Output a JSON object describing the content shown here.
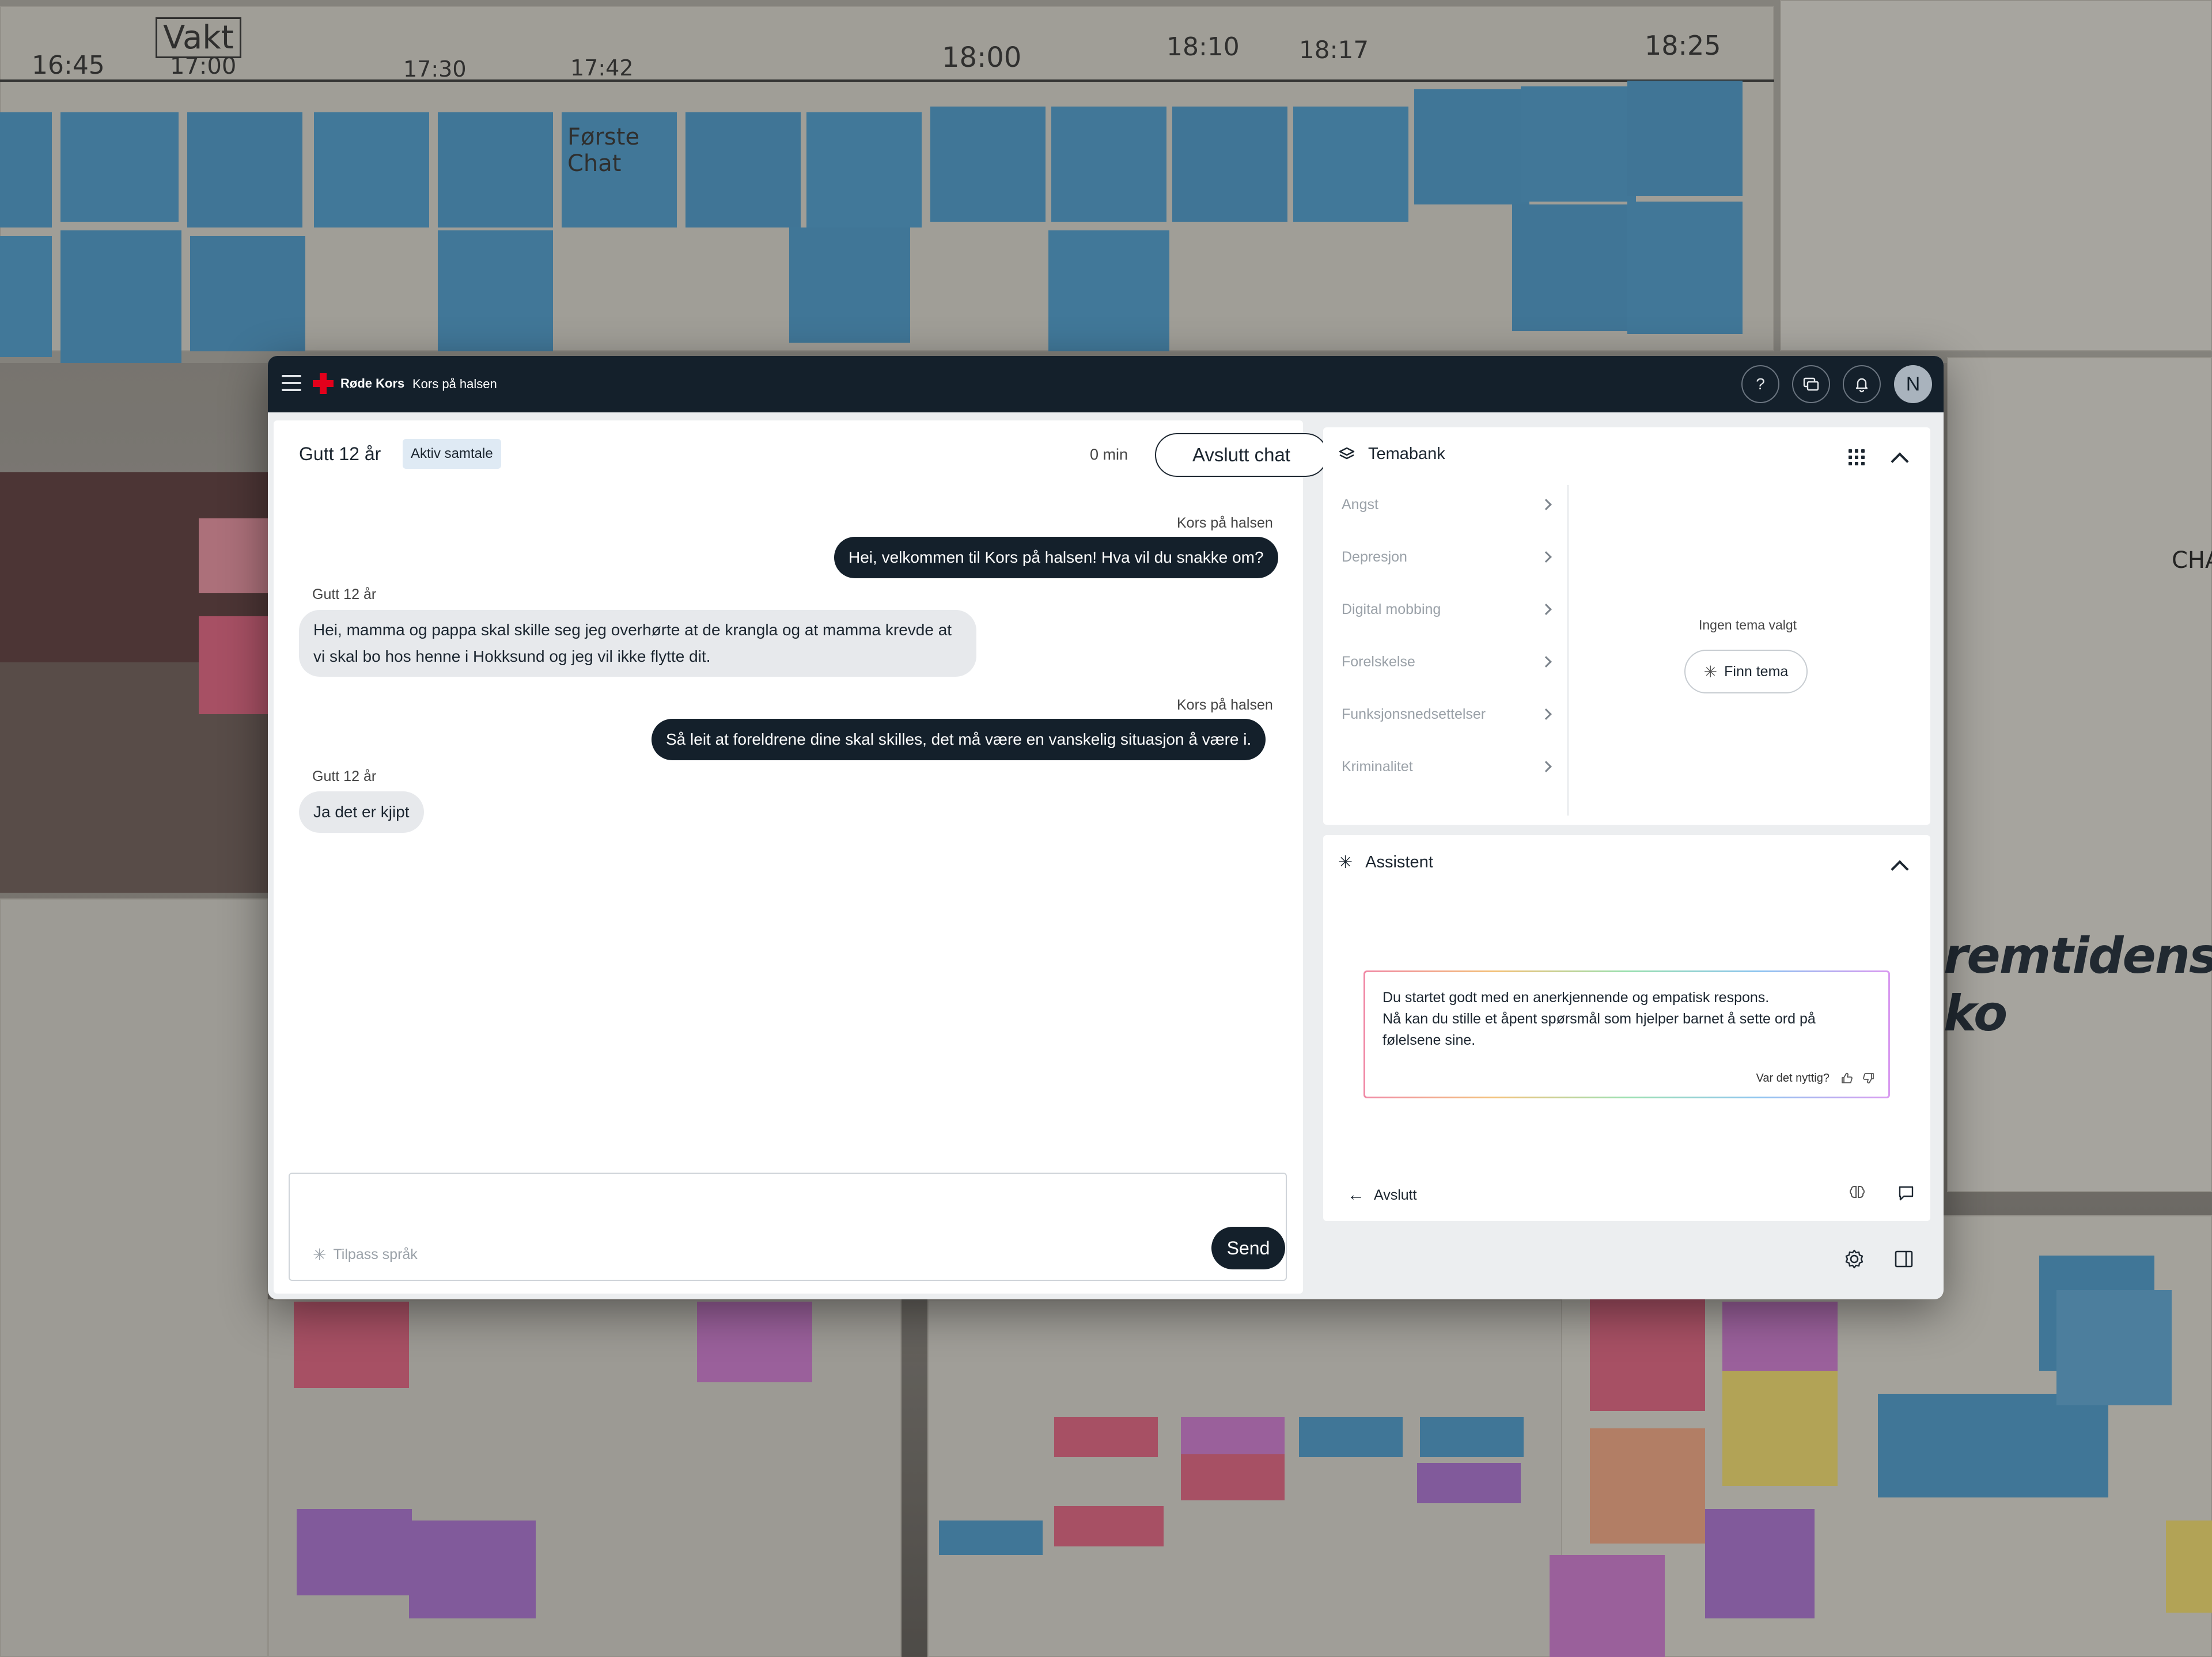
{
  "topbar": {
    "logo_text": "Røde Kors",
    "app_name": "Kors på halsen",
    "help_icon": "?",
    "avatar_initial": "N"
  },
  "chat": {
    "title": "Gutt 12 år",
    "status": "Aktiv samtale",
    "timer": "0 min",
    "end_label": "Avslutt chat",
    "messages": [
      {
        "sender": "Kors på halsen",
        "text": "Hei, velkommen til Kors på halsen! Hva vil du snakke om?",
        "direction": "out"
      },
      {
        "sender": "Gutt 12 år",
        "text": "Hei, mamma og pappa skal skille seg jeg overhørte at de krangla og at mamma krevde at vi skal bo hos henne i Hokksund og jeg vil ikke flytte dit.",
        "direction": "in"
      },
      {
        "sender": "Kors på halsen",
        "text": "Så leit at foreldrene dine skal skilles, det må være en vanskelig situasjon å være i.",
        "direction": "out"
      },
      {
        "sender": "Gutt 12 år",
        "text": "Ja det er kjipt",
        "direction": "in"
      }
    ],
    "composer": {
      "adjust_label": "Tilpass språk",
      "send_label": "Send"
    }
  },
  "temabank": {
    "title": "Temabank",
    "topics": [
      "Angst",
      "Depresjon",
      "Digital mobbing",
      "Forelskelse",
      "Funksjonsnedsettelser",
      "Kriminalitet"
    ],
    "empty_text": "Ingen tema valgt",
    "find_label": "Finn tema"
  },
  "assistant": {
    "title": "Assistent",
    "suggestion": "Du startet godt med en anerkjennende og empatisk respons.\nNå kan du stille et åpent spørsmål som hjelper barnet å sette ord på følelsene sine.",
    "feedback_label": "Var det nyttig?",
    "exit_label": "Avslutt"
  },
  "background": {
    "words": [
      "Vakt",
      "17:00",
      "17:30",
      "17:42",
      "18:00",
      "18:10",
      "18:17",
      "18:25",
      "16:45",
      "Første Chat",
      "remtidens ko",
      "CHAT"
    ]
  },
  "colors": {
    "topbar": "#14202b",
    "brand_red": "#e3001b",
    "status_badge": "#dfeaf4",
    "note_blue": "#4a95c4",
    "note_pink": "#d9607d",
    "note_purple": "#a46ec9"
  }
}
